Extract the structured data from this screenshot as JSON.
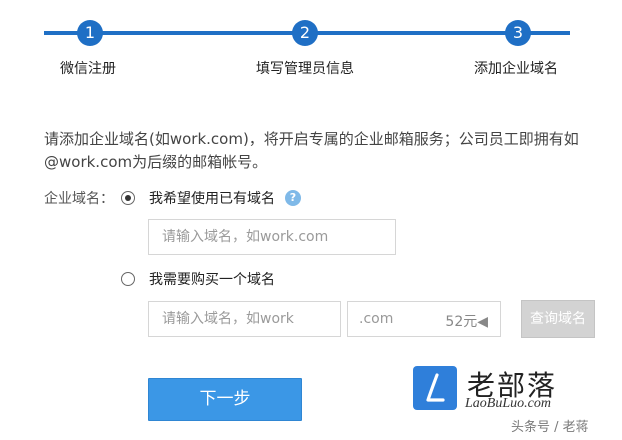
{
  "stepper": {
    "steps": [
      {
        "number": "1",
        "label": "微信注册"
      },
      {
        "number": "2",
        "label": "填写管理员信息"
      },
      {
        "number": "3",
        "label": "添加企业域名"
      }
    ]
  },
  "intro": {
    "text": "请添加企业域名(如work.com)，将开启专属的企业邮箱服务；公司员工即拥有如@work.com为后缀的邮箱帐号。"
  },
  "form": {
    "field_label": "企业域名：",
    "option_existing": {
      "label": "我希望使用已有域名",
      "selected": true,
      "help_icon": "question-icon",
      "help_glyph": "?",
      "input_placeholder": "请输入域名，如work.com"
    },
    "option_buy": {
      "label": "我需要购买一个域名",
      "selected": false,
      "input_placeholder": "请输入域名，如work",
      "suffix": ".com",
      "price": "52元◀",
      "query_button": "查询域名"
    },
    "next_button": "下一步"
  },
  "watermark": {
    "logo_chars": "老部落",
    "logo_url": "LaoBuLuo.com",
    "credit": "头条号 / 老蒋"
  },
  "colors": {
    "accent": "#1f6fc5",
    "button": "#3b97e6",
    "disabled_button": "#d3d3d3",
    "help_icon": "#7fb9e8",
    "logo": "#2f7fda"
  }
}
